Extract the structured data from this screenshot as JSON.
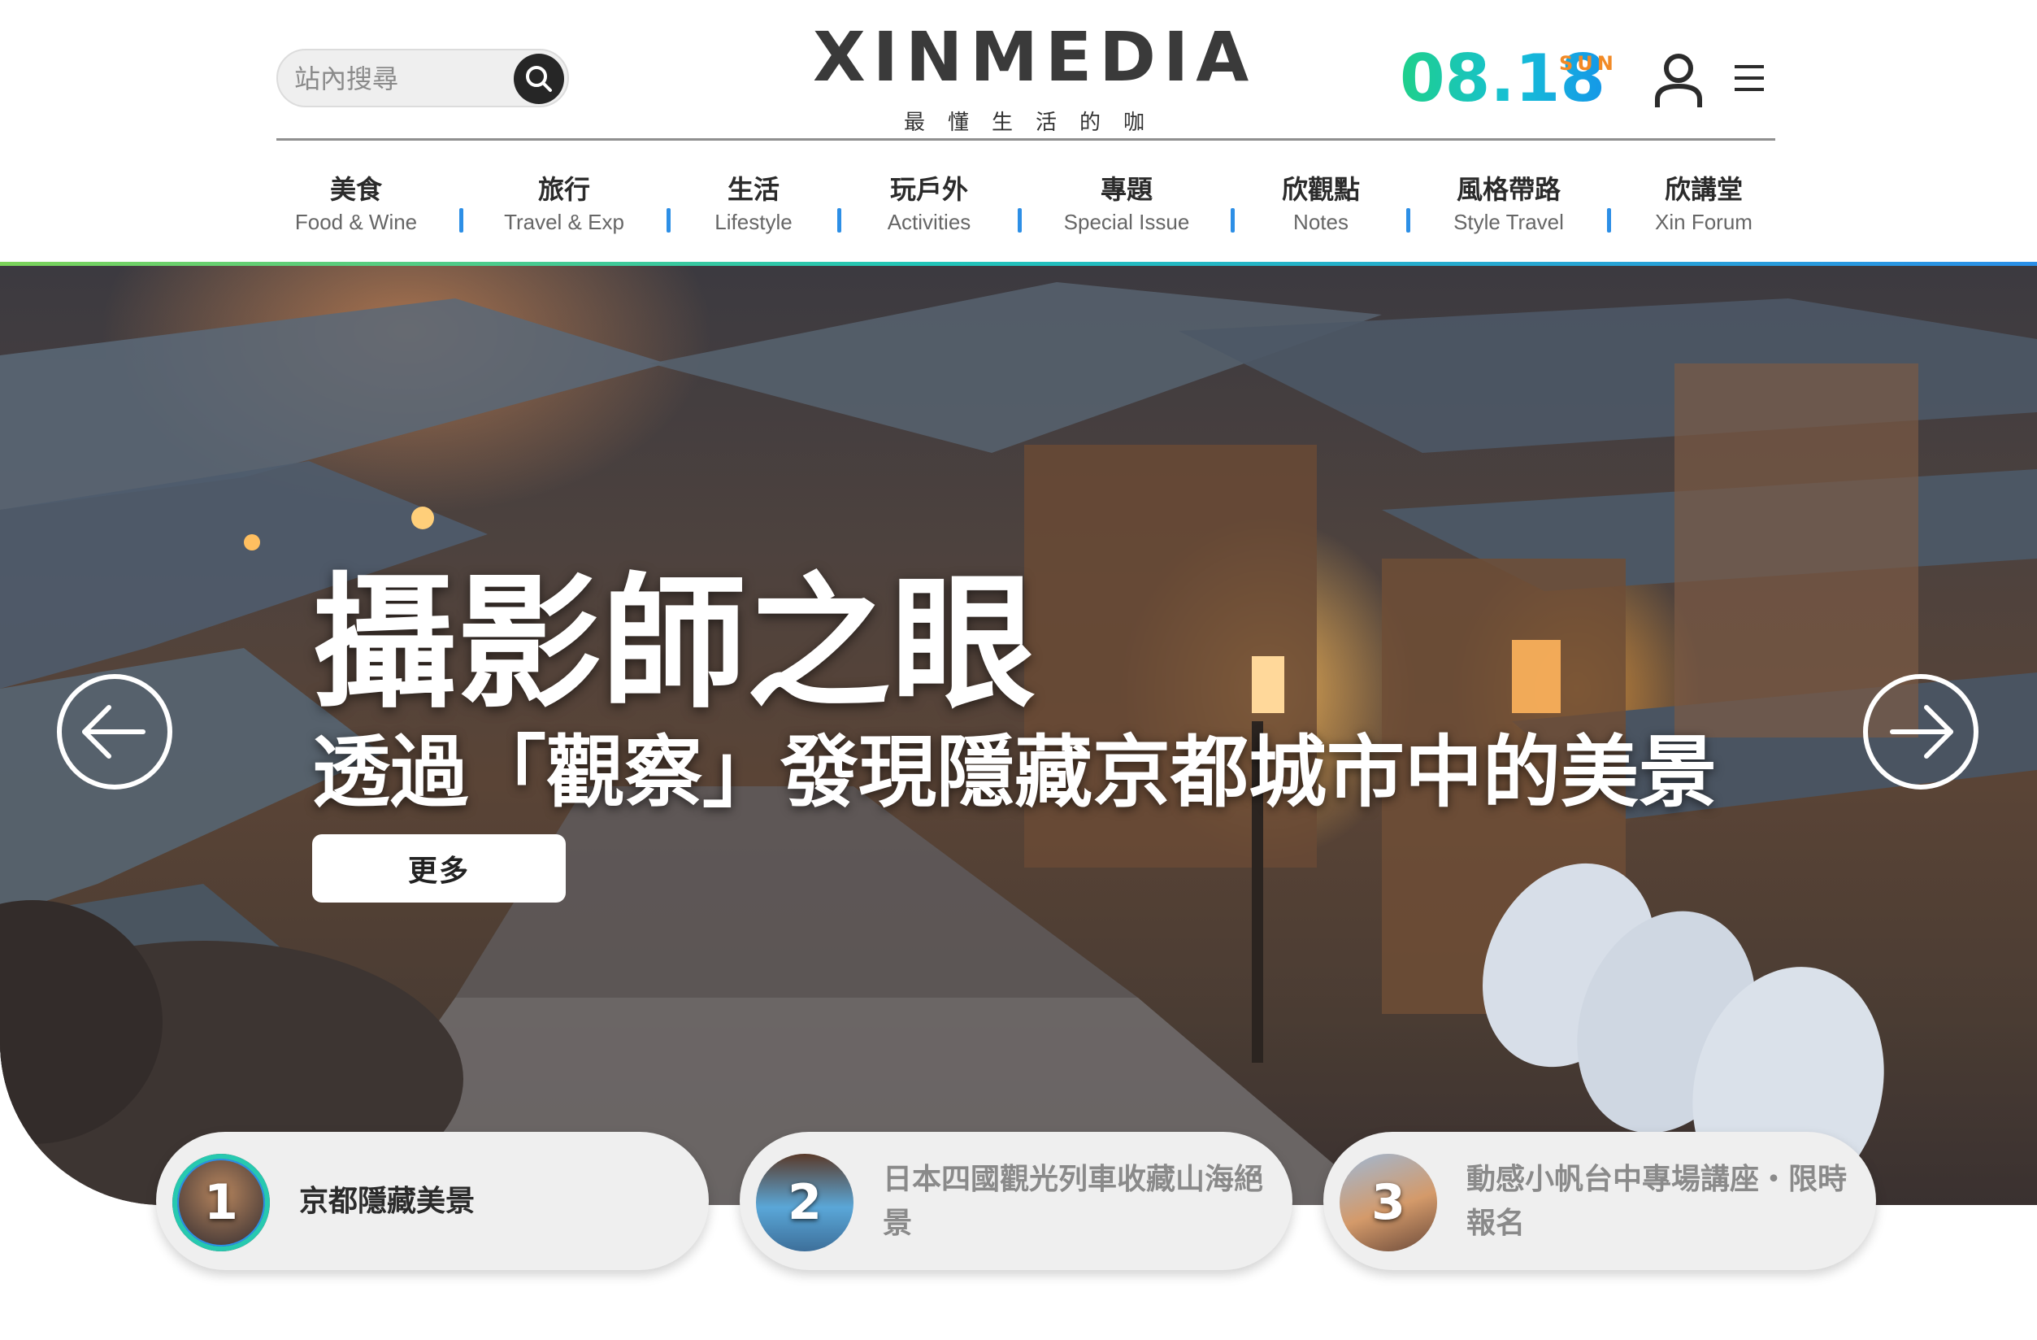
{
  "search": {
    "placeholder": "站內搜尋",
    "icon": "search-icon"
  },
  "brand": {
    "name": "XINMEDIA",
    "tagline": "最懂生活的咖"
  },
  "date": {
    "day": "08.18",
    "weekday": "SUN",
    "gradient": [
      "#1fd08a",
      "#16bfd6",
      "#1597e8"
    ],
    "weekday_color": "#f28a26"
  },
  "header_icons": {
    "user": "user-icon",
    "menu": "hamburger-menu-icon"
  },
  "nav": {
    "items": [
      {
        "zh": "美食",
        "en": "Food & Wine"
      },
      {
        "zh": "旅行",
        "en": "Travel & Exp"
      },
      {
        "zh": "生活",
        "en": "Lifestyle"
      },
      {
        "zh": "玩戶外",
        "en": "Activities"
      },
      {
        "zh": "專題",
        "en": "Special Issue"
      },
      {
        "zh": "欣觀點",
        "en": "Notes"
      },
      {
        "zh": "風格帶路",
        "en": "Style Travel"
      },
      {
        "zh": "欣講堂",
        "en": "Xin Forum"
      }
    ],
    "separator_color": "#2d8fe6"
  },
  "hero": {
    "title": "攝影師之眼",
    "subtitle": "透過「觀察」發現隱藏京都城市中的美景",
    "more_label": "更多",
    "prev_icon": "arrow-left-icon",
    "next_icon": "arrow-right-icon"
  },
  "features": [
    {
      "number": "1",
      "title": "京都隱藏美景",
      "active": true
    },
    {
      "number": "2",
      "title": "日本四國觀光列車收藏山海絕景",
      "active": false
    },
    {
      "number": "3",
      "title": "動感小帆台中專場講座・限時報名",
      "active": false
    }
  ]
}
